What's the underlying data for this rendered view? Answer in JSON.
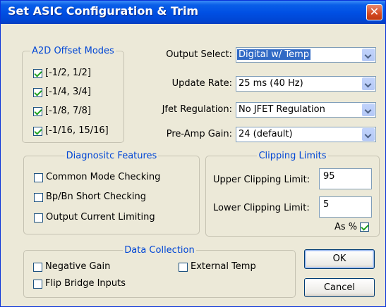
{
  "window": {
    "title": "Set ASIC Configuration & Trim"
  },
  "a2d_offset_modes": {
    "legend": "A2D Offset Modes",
    "options": [
      {
        "label": "[-1/2, 1/2]",
        "checked": true
      },
      {
        "label": "[-1/4, 3/4]",
        "checked": true
      },
      {
        "label": "[-1/8, 7/8]",
        "checked": true
      },
      {
        "label": "[-1/16, 15/16]",
        "checked": true
      }
    ]
  },
  "settings": {
    "output_select": {
      "label": "Output Select:",
      "value": "Digital w/ Temp"
    },
    "update_rate": {
      "label": "Update Rate:",
      "value": "25 ms (40 Hz)"
    },
    "jfet_regulation": {
      "label": "Jfet Regulation:",
      "value": "No JFET Regulation"
    },
    "preamp_gain": {
      "label": "Pre-Amp Gain:",
      "value": "24 (default)"
    }
  },
  "diagnostic_features": {
    "legend": "Diagnositc Features",
    "options": [
      {
        "label": "Common Mode Checking",
        "checked": false
      },
      {
        "label": "Bp/Bn Short Checking",
        "checked": false
      },
      {
        "label": "Output Current Limiting",
        "checked": false
      }
    ]
  },
  "clipping_limits": {
    "legend": "Clipping Limits",
    "upper_label": "Upper Clipping Limit:",
    "upper_value": "95",
    "lower_label": "Lower Clipping Limit:",
    "lower_value": "5",
    "as_percent_label": "As %",
    "as_percent_checked": true
  },
  "data_collection": {
    "legend": "Data Collection",
    "negative_gain": "Negative Gain",
    "external_temp": "External Temp",
    "flip_bridge_inputs": "Flip Bridge Inputs"
  },
  "buttons": {
    "ok": "OK",
    "cancel": "Cancel"
  },
  "colors": {
    "title_bar": "#0050e4",
    "group_legend": "#0046d5",
    "check_mark": "#21a121",
    "selection": "#316ac5"
  }
}
